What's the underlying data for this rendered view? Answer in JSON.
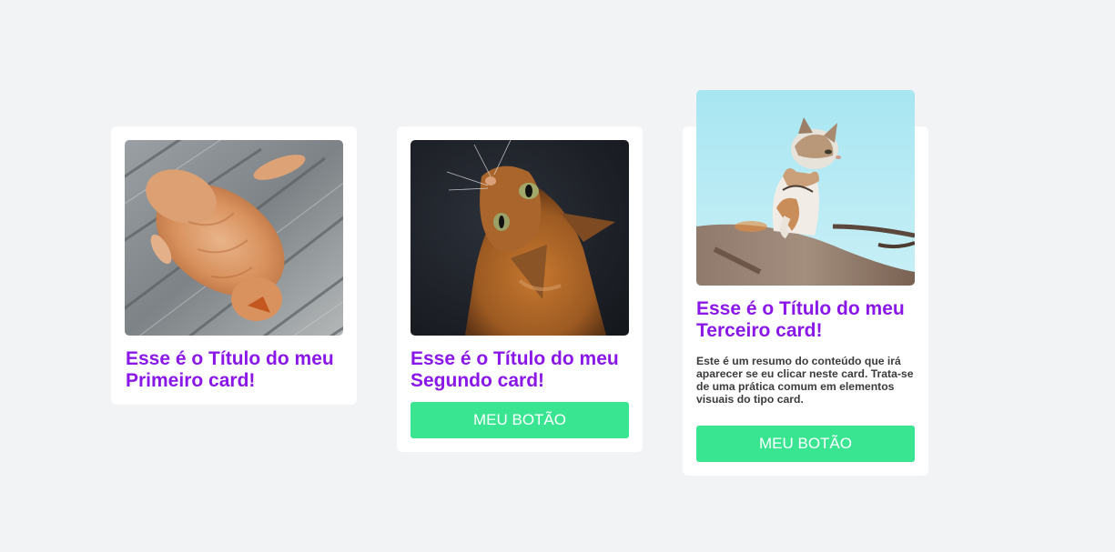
{
  "cards": [
    {
      "title": "Esse é o Título do meu Primeiro card!",
      "image": "photo of an orange tabby cat lying on wooden boards"
    },
    {
      "title": "Esse é o Título do meu Segundo card!",
      "image": "photo of an orange cat looking up against a dark background",
      "button_label": "MEU BOTÃO"
    },
    {
      "title": "Esse é o Título do meu Terceiro card!",
      "summary": "Este é um resumo do conteúdo que irá aparecer se eu clicar neste card. Trata-se de uma prática comum em elementos visuais do tipo card.",
      "image": "photo of a kitten sitting on a tree branch under a light blue sky",
      "button_label": "MEU BOTÃO"
    }
  ],
  "colors": {
    "page_background": "#f2f3f5",
    "card_background": "#ffffff",
    "title_color": "#8a17e8",
    "button_color": "#3ae592",
    "button_text": "#ffffff"
  }
}
